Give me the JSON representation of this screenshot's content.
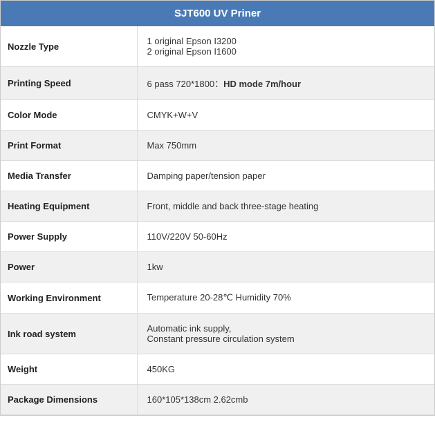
{
  "header": {
    "title": "SJT600 UV Priner"
  },
  "rows": [
    {
      "id": "nozzle-type",
      "label": "Nozzle Type",
      "value": "1 original Epson I3200\n2 original Epson I1600",
      "shade": "white",
      "bold_part": null
    },
    {
      "id": "printing-speed",
      "label": "Printing Speed",
      "value": "6 pass 720*1800：",
      "value_bold": "HD mode 7m/hour",
      "shade": "gray",
      "has_bold": true
    },
    {
      "id": "color-mode",
      "label": "Color Mode",
      "value": "CMYK+W+V",
      "shade": "white",
      "has_bold": false
    },
    {
      "id": "print-format",
      "label": "Print Format",
      "value": "Max 750mm",
      "shade": "gray",
      "has_bold": false
    },
    {
      "id": "media-transfer",
      "label": "Media Transfer",
      "value": "Damping paper/tension paper",
      "shade": "white",
      "has_bold": false
    },
    {
      "id": "heating-equipment",
      "label": "Heating Equipment",
      "value": "Front, middle and back three-stage heating",
      "shade": "gray",
      "has_bold": false
    },
    {
      "id": "power-supply",
      "label": "Power Supply",
      "value": "110V/220V 50-60Hz",
      "shade": "white",
      "has_bold": false
    },
    {
      "id": "power",
      "label": "Power",
      "value": "1kw",
      "shade": "gray",
      "has_bold": false
    },
    {
      "id": "working-environment",
      "label": "Working Environment",
      "value": "Temperature 20-28℃  Humidity 70%",
      "shade": "white",
      "has_bold": false
    },
    {
      "id": "ink-road-system",
      "label": "Ink road system",
      "value": "Automatic ink supply,\nConstant pressure circulation system",
      "shade": "gray",
      "has_bold": false
    },
    {
      "id": "weight",
      "label": "Weight",
      "value": "450KG",
      "shade": "white",
      "has_bold": false
    },
    {
      "id": "package-dimensions",
      "label": "Package Dimensions",
      "value": "160*105*138cm  2.62cmb",
      "shade": "gray",
      "has_bold": false
    }
  ]
}
